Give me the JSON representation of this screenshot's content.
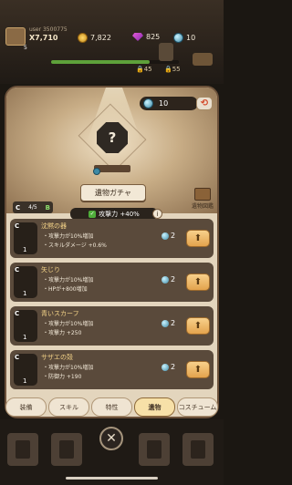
{
  "header": {
    "player_name": "user 3500775",
    "power": "X7,710",
    "level": "5",
    "coins": "7,822",
    "gems": "825",
    "orbs": "10",
    "xp_progress": 0.77,
    "lock_left": "45",
    "lock_right": "55"
  },
  "gacha": {
    "currency_count": "10",
    "mystery_symbol": "?",
    "button_label": "遺物ガチャ",
    "book_label": "遺物図鑑",
    "slot_grade": "C",
    "slot_count": "4/5",
    "slot_next_grade": "B",
    "bonus_text": "攻撃力 +40%"
  },
  "relics": [
    {
      "grade": "C",
      "level": "1",
      "name": "沈黙の器",
      "line1": "・攻撃力が10%増加",
      "line2": "・スキルダメージ +0.6%",
      "count": "2"
    },
    {
      "grade": "C",
      "level": "1",
      "name": "矢じり",
      "line1": "・攻撃力が10%増加",
      "line2": "・HPが+800増加",
      "count": "2"
    },
    {
      "grade": "C",
      "level": "1",
      "name": "青いスカーフ",
      "line1": "・攻撃力が10%増加",
      "line2": "・攻撃力 +250",
      "count": "2"
    },
    {
      "grade": "C",
      "level": "1",
      "name": "サザエの殻",
      "line1": "・攻撃力が10%増加",
      "line2": "・防御力 +190",
      "count": "2"
    }
  ],
  "tabs": [
    "装備",
    "スキル",
    "特性",
    "遺物",
    "コスチューム"
  ],
  "close_symbol": "✕"
}
